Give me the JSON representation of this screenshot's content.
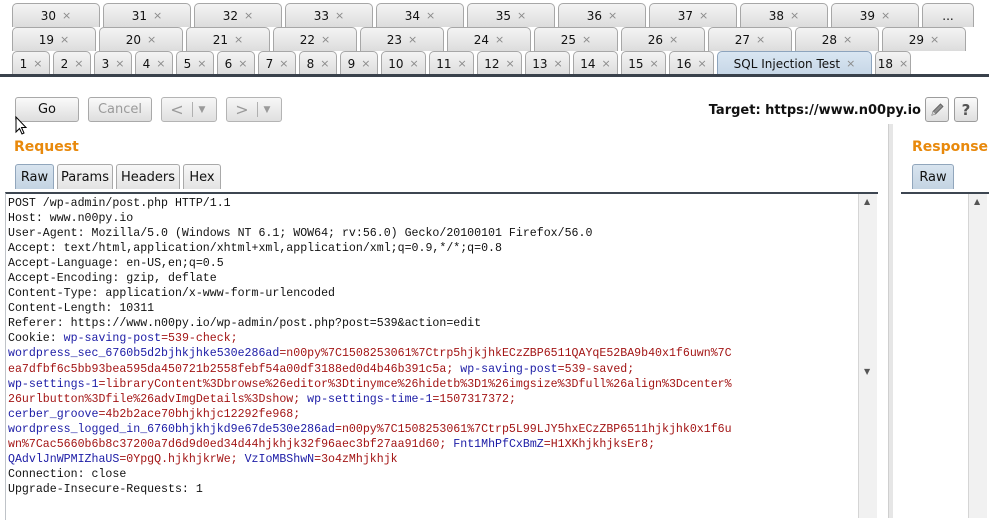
{
  "tabs": {
    "row1": [
      "30",
      "31",
      "32",
      "33",
      "34",
      "35",
      "36",
      "37",
      "38",
      "39",
      "..."
    ],
    "row2": [
      "19",
      "20",
      "21",
      "22",
      "23",
      "24",
      "25",
      "26",
      "27",
      "28",
      "29"
    ],
    "row3": [
      "1",
      "2",
      "3",
      "4",
      "5",
      "6",
      "7",
      "8",
      "9",
      "10",
      "11",
      "12",
      "13",
      "14",
      "15",
      "16",
      "SQL Injection Test",
      "18"
    ],
    "active": "SQL Injection Test",
    "close_glyph": "×"
  },
  "toolbar": {
    "go_label": "Go",
    "cancel_label": "Cancel",
    "back_glyph": "<",
    "forward_glyph": ">",
    "dropdown_glyph": "▼",
    "target_text": "Target: https://www.n00py.io",
    "edit_icon": "pencil-icon",
    "help_label": "?"
  },
  "request": {
    "title": "Request",
    "tabs": [
      "Raw",
      "Params",
      "Headers",
      "Hex"
    ],
    "active_tab": "Raw",
    "lines": [
      {
        "segs": [
          {
            "t": "POST /wp-admin/post.php HTTP/1.1",
            "c": ""
          }
        ]
      },
      {
        "segs": [
          {
            "t": "Host: www.n00py.io",
            "c": ""
          }
        ]
      },
      {
        "segs": [
          {
            "t": "User-Agent: Mozilla/5.0 (Windows NT 6.1; WOW64; rv:56.0) Gecko/20100101 Firefox/56.0",
            "c": ""
          }
        ]
      },
      {
        "segs": [
          {
            "t": "Accept: text/html,application/xhtml+xml,application/xml;q=0.9,*/*;q=0.8",
            "c": ""
          }
        ]
      },
      {
        "segs": [
          {
            "t": "Accept-Language: en-US,en;q=0.5",
            "c": ""
          }
        ]
      },
      {
        "segs": [
          {
            "t": "Accept-Encoding: gzip, deflate",
            "c": ""
          }
        ]
      },
      {
        "segs": [
          {
            "t": "Content-Type: application/x-www-form-urlencoded",
            "c": ""
          }
        ]
      },
      {
        "segs": [
          {
            "t": "Content-Length: 10311",
            "c": ""
          }
        ]
      },
      {
        "segs": [
          {
            "t": "Referer: https://www.n00py.io/wp-admin/post.php?post=539&action=edit",
            "c": ""
          }
        ]
      },
      {
        "segs": [
          {
            "t": "Cookie: ",
            "c": ""
          },
          {
            "t": "wp-saving-post",
            "c": "kw"
          },
          {
            "t": "=539-check;",
            "c": "val"
          }
        ]
      },
      {
        "segs": [
          {
            "t": "wordpress_sec_6760b5d2bjhkjhke530e286ad",
            "c": "kw"
          },
          {
            "t": "=n00py%7C1508253061%7Ctrp5hjkjhkECzZBP6511QAYqE52BA9b40x1f6uwn%7C",
            "c": "val"
          }
        ]
      },
      {
        "segs": [
          {
            "t": "ea7dfbf6c5bb93bea595da450721b2558febf54a00df3188ed0d4b46b391c5a;",
            "c": "val"
          },
          {
            "t": " wp-saving-post",
            "c": "kw"
          },
          {
            "t": "=539-saved;",
            "c": "val"
          }
        ]
      },
      {
        "segs": [
          {
            "t": "wp-settings-1",
            "c": "kw"
          },
          {
            "t": "=libraryContent%3Dbrowse%26editor%3Dtinymce%26hidetb%3D1%26imgsize%3Dfull%26align%3Dcenter%",
            "c": "val"
          }
        ]
      },
      {
        "segs": [
          {
            "t": "26urlbutton%3Dfile%26advImgDetails%3Dshow;",
            "c": "val"
          },
          {
            "t": " wp-settings-time-1",
            "c": "kw"
          },
          {
            "t": "=1507317372;",
            "c": "val"
          }
        ]
      },
      {
        "segs": [
          {
            "t": "cerber_groove",
            "c": "kw"
          },
          {
            "t": "=4b2b2ace70bhjkhjc12292fe968;",
            "c": "val"
          }
        ]
      },
      {
        "segs": [
          {
            "t": "wordpress_logged_in_6760bhjkhjkd9e67de530e286ad",
            "c": "kw"
          },
          {
            "t": "=n00py%7C1508253061%7Ctrp5L99LJY5hxECzZBP6511hjkjhk0x1f6u",
            "c": "val"
          }
        ]
      },
      {
        "segs": [
          {
            "t": "wn%7Cac5660b6b8c37200a7d6d9d0ed34d44hjkhjk32f96aec3bf27aa91d60;",
            "c": "val"
          },
          {
            "t": " Fnt1MhPfCxBmZ",
            "c": "kw"
          },
          {
            "t": "=H1XKhjkhjksEr8;",
            "c": "val"
          }
        ]
      },
      {
        "segs": [
          {
            "t": "QAdvlJnWPMIZhaUS",
            "c": "kw"
          },
          {
            "t": "=0YpgQ.hjkhjkrWe;",
            "c": "val"
          },
          {
            "t": " VzIoMBShwN",
            "c": "kw"
          },
          {
            "t": "=3o4zMhjkhjk",
            "c": "val"
          }
        ]
      },
      {
        "segs": [
          {
            "t": "Connection: close",
            "c": ""
          }
        ]
      },
      {
        "segs": [
          {
            "t": "Upgrade-Insecure-Requests: 1",
            "c": ""
          }
        ]
      }
    ]
  },
  "response": {
    "title": "Response",
    "tabs": [
      "Raw"
    ]
  },
  "colors": {
    "section_title": "#e8890c",
    "param_name": "#1c1ca6",
    "param_value": "#a31515"
  }
}
